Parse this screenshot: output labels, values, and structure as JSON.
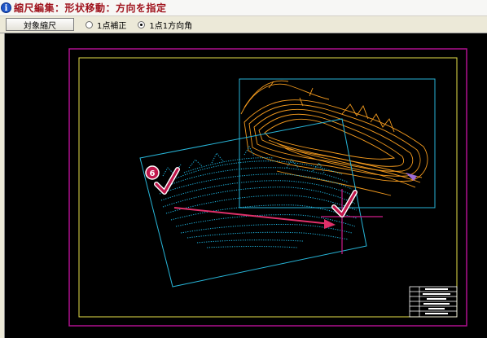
{
  "header": {
    "title": "縮尺編集：形状移動：方向を指定",
    "info_icon": "info-icon"
  },
  "toolbar": {
    "target_scale_button": "対象縮尺",
    "options": [
      {
        "label": "1点補正",
        "selected": false
      },
      {
        "label": "1点1方向角",
        "selected": true
      }
    ]
  },
  "canvas": {
    "step_marker": "6",
    "colors": {
      "outer_frame": "#b0108f",
      "inner_frame": "#e7e24a",
      "bounding_boxes": "#27b5d8",
      "terrain_orange": "#f39a1e",
      "terrain_cyan": "#1fb9e5",
      "arrow": "#e0306a",
      "check_mark": "#c0164c"
    }
  }
}
